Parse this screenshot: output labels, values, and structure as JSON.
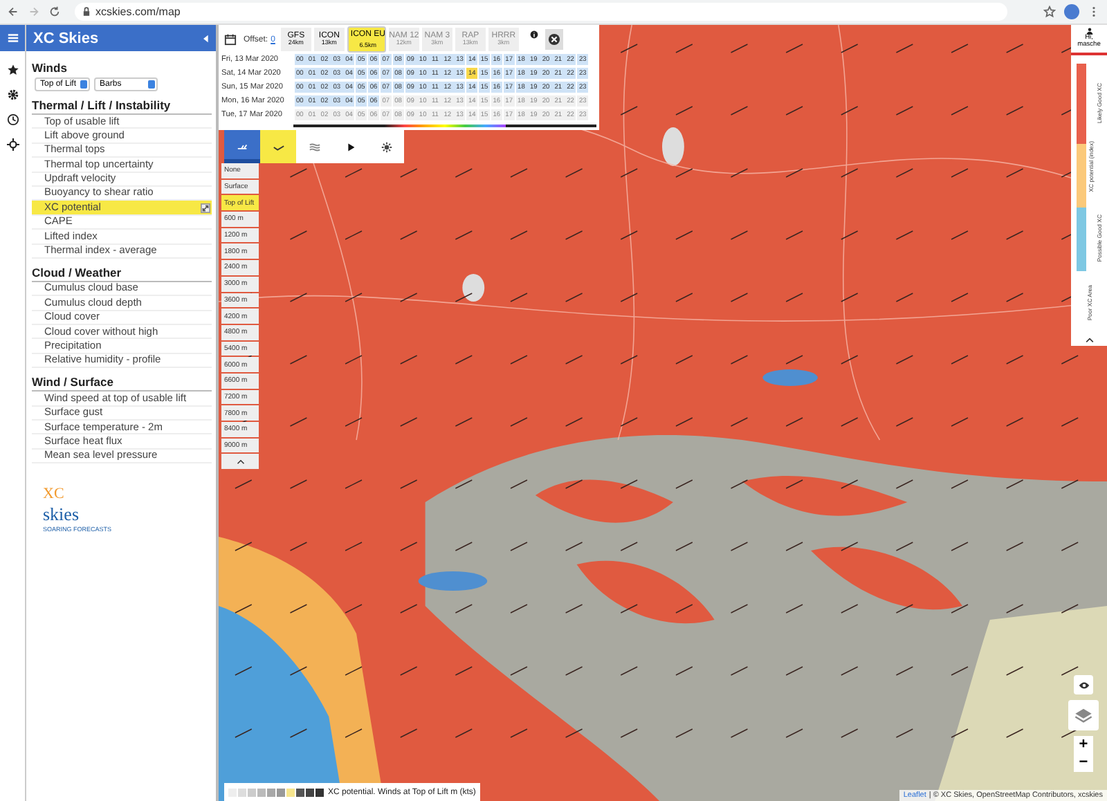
{
  "browser": {
    "url": "xcskies.com/map"
  },
  "sidebar": {
    "title": "XC Skies",
    "winds": {
      "title": "Winds",
      "level_select": "Top of Lift",
      "style_select": "Barbs"
    },
    "sections": [
      {
        "title": "Thermal / Lift / Instability",
        "items": [
          {
            "label": "Top of usable lift",
            "selected": false
          },
          {
            "label": "Lift above ground",
            "selected": false
          },
          {
            "label": "Thermal tops",
            "selected": false
          },
          {
            "label": "Thermal top uncertainty",
            "selected": false
          },
          {
            "label": "Updraft velocity",
            "selected": false
          },
          {
            "label": "Buoyancy to shear ratio",
            "selected": false
          },
          {
            "label": "XC potential",
            "selected": true
          },
          {
            "label": "CAPE",
            "selected": false
          },
          {
            "label": "Lifted index",
            "selected": false
          },
          {
            "label": "Thermal index - average",
            "selected": false
          }
        ]
      },
      {
        "title": "Cloud / Weather",
        "items": [
          {
            "label": "Cumulus cloud base",
            "selected": false
          },
          {
            "label": "Cumulus cloud depth",
            "selected": false
          },
          {
            "label": "Cloud cover",
            "selected": false
          },
          {
            "label": "Cloud cover without high",
            "selected": false
          },
          {
            "label": "Precipitation",
            "selected": false
          },
          {
            "label": "Relative humidity - profile",
            "selected": false
          }
        ]
      },
      {
        "title": "Wind / Surface",
        "items": [
          {
            "label": "Wind speed at top of usable lift",
            "selected": false
          },
          {
            "label": "Surface gust",
            "selected": false
          },
          {
            "label": "Surface temperature - 2m",
            "selected": false
          },
          {
            "label": "Surface heat flux",
            "selected": false
          },
          {
            "label": "Mean sea level pressure",
            "selected": false
          }
        ]
      }
    ],
    "logo": {
      "mark": "XC",
      "name": "skies",
      "tagline": "SOARING FORECASTS"
    }
  },
  "time_panel": {
    "offset_label": "Offset:",
    "offset_value": "0",
    "models": [
      {
        "name": "GFS",
        "resolution": "24km",
        "selected": false,
        "disabled": false
      },
      {
        "name": "ICON",
        "resolution": "13km",
        "selected": false,
        "disabled": false
      },
      {
        "name": "ICON EU",
        "resolution": "6.5km",
        "selected": true,
        "disabled": false
      },
      {
        "name": "NAM 12",
        "resolution": "12km",
        "selected": false,
        "disabled": true
      },
      {
        "name": "NAM 3",
        "resolution": "3km",
        "selected": false,
        "disabled": true
      },
      {
        "name": "RAP",
        "resolution": "13km",
        "selected": false,
        "disabled": true
      },
      {
        "name": "HRRR",
        "resolution": "3km",
        "selected": false,
        "disabled": true
      }
    ],
    "days": [
      {
        "date": "Fri, 13 Mar 2020",
        "hours": [
          {
            "h": "00",
            "available": true,
            "selected": false
          },
          {
            "h": "01",
            "available": true,
            "selected": false
          },
          {
            "h": "02",
            "available": true,
            "selected": false
          },
          {
            "h": "03",
            "available": true,
            "selected": false
          },
          {
            "h": "04",
            "available": true,
            "selected": false
          },
          {
            "h": "05",
            "available": true,
            "selected": false
          },
          {
            "h": "06",
            "available": true,
            "selected": false
          },
          {
            "h": "07",
            "available": true,
            "selected": false
          },
          {
            "h": "08",
            "available": true,
            "selected": false
          },
          {
            "h": "09",
            "available": true,
            "selected": false
          },
          {
            "h": "10",
            "available": true,
            "selected": false
          },
          {
            "h": "11",
            "available": true,
            "selected": false
          },
          {
            "h": "12",
            "available": true,
            "selected": false
          },
          {
            "h": "13",
            "available": true,
            "selected": false
          },
          {
            "h": "14",
            "available": true,
            "selected": false
          },
          {
            "h": "15",
            "available": true,
            "selected": false
          },
          {
            "h": "16",
            "available": true,
            "selected": false
          },
          {
            "h": "17",
            "available": true,
            "selected": false
          },
          {
            "h": "18",
            "available": true,
            "selected": false
          },
          {
            "h": "19",
            "available": true,
            "selected": false
          },
          {
            "h": "20",
            "available": true,
            "selected": false
          },
          {
            "h": "21",
            "available": true,
            "selected": false
          },
          {
            "h": "22",
            "available": true,
            "selected": false
          },
          {
            "h": "23",
            "available": true,
            "selected": false
          }
        ]
      },
      {
        "date": "Sat, 14 Mar 2020",
        "hours": [
          {
            "h": "00",
            "available": true,
            "selected": false
          },
          {
            "h": "01",
            "available": true,
            "selected": false
          },
          {
            "h": "02",
            "available": true,
            "selected": false
          },
          {
            "h": "03",
            "available": true,
            "selected": false
          },
          {
            "h": "04",
            "available": true,
            "selected": false
          },
          {
            "h": "05",
            "available": true,
            "selected": false
          },
          {
            "h": "06",
            "available": true,
            "selected": false
          },
          {
            "h": "07",
            "available": true,
            "selected": false
          },
          {
            "h": "08",
            "available": true,
            "selected": false
          },
          {
            "h": "09",
            "available": true,
            "selected": false
          },
          {
            "h": "10",
            "available": true,
            "selected": false
          },
          {
            "h": "11",
            "available": true,
            "selected": false
          },
          {
            "h": "12",
            "available": true,
            "selected": false
          },
          {
            "h": "13",
            "available": true,
            "selected": false
          },
          {
            "h": "14",
            "available": true,
            "selected": true
          },
          {
            "h": "15",
            "available": true,
            "selected": false
          },
          {
            "h": "16",
            "available": true,
            "selected": false
          },
          {
            "h": "17",
            "available": true,
            "selected": false
          },
          {
            "h": "18",
            "available": true,
            "selected": false
          },
          {
            "h": "19",
            "available": true,
            "selected": false
          },
          {
            "h": "20",
            "available": true,
            "selected": false
          },
          {
            "h": "21",
            "available": true,
            "selected": false
          },
          {
            "h": "22",
            "available": true,
            "selected": false
          },
          {
            "h": "23",
            "available": true,
            "selected": false
          }
        ]
      },
      {
        "date": "Sun, 15 Mar 2020",
        "hours": [
          {
            "h": "00",
            "available": true,
            "selected": false
          },
          {
            "h": "01",
            "available": true,
            "selected": false
          },
          {
            "h": "02",
            "available": true,
            "selected": false
          },
          {
            "h": "03",
            "available": true,
            "selected": false
          },
          {
            "h": "04",
            "available": true,
            "selected": false
          },
          {
            "h": "05",
            "available": true,
            "selected": false
          },
          {
            "h": "06",
            "available": true,
            "selected": false
          },
          {
            "h": "07",
            "available": true,
            "selected": false
          },
          {
            "h": "08",
            "available": true,
            "selected": false
          },
          {
            "h": "09",
            "available": true,
            "selected": false
          },
          {
            "h": "10",
            "available": true,
            "selected": false
          },
          {
            "h": "11",
            "available": true,
            "selected": false
          },
          {
            "h": "12",
            "available": true,
            "selected": false
          },
          {
            "h": "13",
            "available": true,
            "selected": false
          },
          {
            "h": "14",
            "available": true,
            "selected": false
          },
          {
            "h": "15",
            "available": true,
            "selected": false
          },
          {
            "h": "16",
            "available": true,
            "selected": false
          },
          {
            "h": "17",
            "available": true,
            "selected": false
          },
          {
            "h": "18",
            "available": true,
            "selected": false
          },
          {
            "h": "19",
            "available": true,
            "selected": false
          },
          {
            "h": "20",
            "available": true,
            "selected": false
          },
          {
            "h": "21",
            "available": true,
            "selected": false
          },
          {
            "h": "22",
            "available": true,
            "selected": false
          },
          {
            "h": "23",
            "available": true,
            "selected": false
          }
        ]
      },
      {
        "date": "Mon, 16 Mar 2020",
        "hours": [
          {
            "h": "00",
            "available": true,
            "selected": false
          },
          {
            "h": "01",
            "available": true,
            "selected": false
          },
          {
            "h": "02",
            "available": true,
            "selected": false
          },
          {
            "h": "03",
            "available": true,
            "selected": false
          },
          {
            "h": "04",
            "available": true,
            "selected": false
          },
          {
            "h": "05",
            "available": true,
            "selected": false
          },
          {
            "h": "06",
            "available": true,
            "selected": false
          },
          {
            "h": "07",
            "available": false,
            "selected": false
          },
          {
            "h": "08",
            "available": false,
            "selected": false
          },
          {
            "h": "09",
            "available": false,
            "selected": false
          },
          {
            "h": "10",
            "available": false,
            "selected": false
          },
          {
            "h": "11",
            "available": false,
            "selected": false
          },
          {
            "h": "12",
            "available": false,
            "selected": false
          },
          {
            "h": "13",
            "available": false,
            "selected": false
          },
          {
            "h": "14",
            "available": false,
            "selected": false
          },
          {
            "h": "15",
            "available": false,
            "selected": false
          },
          {
            "h": "16",
            "available": false,
            "selected": false
          },
          {
            "h": "17",
            "available": false,
            "selected": false
          },
          {
            "h": "18",
            "available": false,
            "selected": false
          },
          {
            "h": "19",
            "available": false,
            "selected": false
          },
          {
            "h": "20",
            "available": false,
            "selected": false
          },
          {
            "h": "21",
            "available": false,
            "selected": false
          },
          {
            "h": "22",
            "available": false,
            "selected": false
          },
          {
            "h": "23",
            "available": false,
            "selected": false
          }
        ]
      },
      {
        "date": "Tue, 17 Mar 2020",
        "hours": [
          {
            "h": "00",
            "available": false,
            "selected": false
          },
          {
            "h": "01",
            "available": false,
            "selected": false
          },
          {
            "h": "02",
            "available": false,
            "selected": false
          },
          {
            "h": "03",
            "available": false,
            "selected": false
          },
          {
            "h": "04",
            "available": false,
            "selected": false
          },
          {
            "h": "05",
            "available": false,
            "selected": false
          },
          {
            "h": "06",
            "available": false,
            "selected": false
          },
          {
            "h": "07",
            "available": false,
            "selected": false
          },
          {
            "h": "08",
            "available": false,
            "selected": false
          },
          {
            "h": "09",
            "available": false,
            "selected": false
          },
          {
            "h": "10",
            "available": false,
            "selected": false
          },
          {
            "h": "11",
            "available": false,
            "selected": false
          },
          {
            "h": "12",
            "available": false,
            "selected": false
          },
          {
            "h": "13",
            "available": false,
            "selected": false
          },
          {
            "h": "14",
            "available": false,
            "selected": false
          },
          {
            "h": "15",
            "available": false,
            "selected": false
          },
          {
            "h": "16",
            "available": false,
            "selected": false
          },
          {
            "h": "17",
            "available": false,
            "selected": false
          },
          {
            "h": "18",
            "available": false,
            "selected": false
          },
          {
            "h": "19",
            "available": false,
            "selected": false
          },
          {
            "h": "20",
            "available": false,
            "selected": false
          },
          {
            "h": "21",
            "available": false,
            "selected": false
          },
          {
            "h": "22",
            "available": false,
            "selected": false
          },
          {
            "h": "23",
            "available": false,
            "selected": false
          }
        ]
      }
    ]
  },
  "map_tools": [
    {
      "kind": "wind",
      "selected": true,
      "highlighted": false
    },
    {
      "kind": "check",
      "selected": false,
      "highlighted": true
    },
    {
      "kind": "waves",
      "selected": false,
      "highlighted": false
    },
    {
      "kind": "play",
      "selected": false,
      "highlighted": false
    },
    {
      "kind": "sun",
      "selected": false,
      "highlighted": false
    }
  ],
  "altitudes": [
    {
      "label": "None",
      "selected": false
    },
    {
      "label": "Surface",
      "selected": false
    },
    {
      "label": "Top of Lift",
      "selected": true
    },
    {
      "label": "600 m",
      "selected": false
    },
    {
      "label": "1200 m",
      "selected": false
    },
    {
      "label": "1800 m",
      "selected": false
    },
    {
      "label": "2400 m",
      "selected": false
    },
    {
      "label": "3000 m",
      "selected": false
    },
    {
      "label": "3600 m",
      "selected": false
    },
    {
      "label": "4200 m",
      "selected": false
    },
    {
      "label": "4800 m",
      "selected": false
    },
    {
      "label": "5400 m",
      "selected": false
    },
    {
      "label": "6000 m",
      "selected": false
    },
    {
      "label": "6600 m",
      "selected": false
    },
    {
      "label": "7200 m",
      "selected": false
    },
    {
      "label": "7800 m",
      "selected": false
    },
    {
      "label": "8400 m",
      "selected": false
    },
    {
      "label": "9000 m",
      "selected": false
    }
  ],
  "user": {
    "greeting": "Hi,",
    "name": "masche"
  },
  "xc_legend": {
    "title": "XC potential (index)",
    "bands": [
      {
        "label": "Likely Good XC",
        "color": "#e8604c"
      },
      {
        "color": "#fbc97a"
      },
      {
        "label": "Possible Good XC",
        "color": "#7ec8e3"
      }
    ],
    "below": "Poor XC Area"
  },
  "map_legend": {
    "swatches": [
      {
        "color": "#eeeeee"
      },
      {
        "color": "#dddddd"
      },
      {
        "color": "#cccccc"
      },
      {
        "color": "#bbbbbb"
      },
      {
        "color": "#a8a8a8"
      },
      {
        "color": "#999999"
      },
      {
        "color": "#f6e58d"
      },
      {
        "color": "#555555"
      },
      {
        "color": "#444444"
      },
      {
        "color": "#333333"
      }
    ],
    "text": "XC potential. Winds at Top of Lift m (kts)"
  },
  "attribution": {
    "link": "Leaflet",
    "text": "| © XC Skies, OpenStreetMap Contributors, xcskies"
  },
  "zoom": {
    "in": "+",
    "out": "−"
  }
}
